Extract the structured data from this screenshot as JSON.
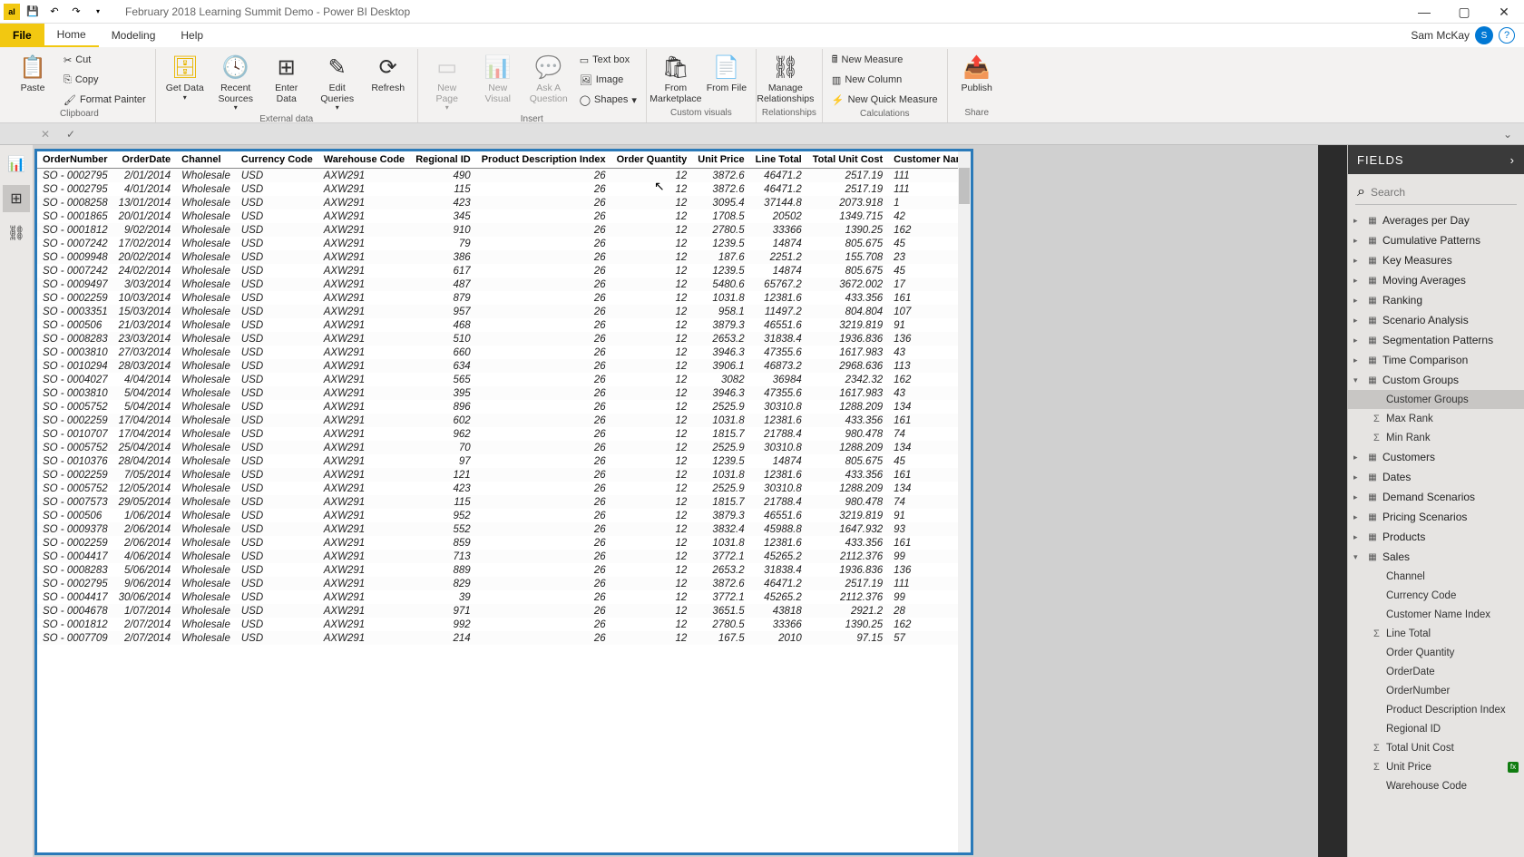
{
  "title": "February 2018 Learning Summit Demo - Power BI Desktop",
  "user": "Sam McKay",
  "tabs": {
    "file": "File",
    "home": "Home",
    "modeling": "Modeling",
    "help": "Help"
  },
  "ribbon": {
    "clipboard": {
      "paste": "Paste",
      "cut": "Cut",
      "copy": "Copy",
      "format_painter": "Format Painter",
      "label": "Clipboard"
    },
    "external": {
      "get_data": "Get Data",
      "recent": "Recent Sources",
      "enter": "Enter Data",
      "edit": "Edit Queries",
      "refresh": "Refresh",
      "label": "External data"
    },
    "insert": {
      "new_page": "New Page",
      "new_visual": "New Visual",
      "ask": "Ask A Question",
      "textbox": "Text box",
      "image": "Image",
      "shapes": "Shapes",
      "label": "Insert"
    },
    "custom": {
      "marketplace": "From Marketplace",
      "file": "From File",
      "label": "Custom visuals"
    },
    "rel": {
      "manage": "Manage Relationships",
      "label": "Relationships"
    },
    "calc": {
      "measure": "New Measure",
      "column": "New Column",
      "quick": "New Quick Measure",
      "label": "Calculations"
    },
    "share": {
      "publish": "Publish",
      "label": "Share"
    }
  },
  "fields_header": "FIELDS",
  "search_placeholder": "Search",
  "tables": [
    {
      "name": "Averages per Day",
      "exp": false
    },
    {
      "name": "Cumulative Patterns",
      "exp": false
    },
    {
      "name": "Key Measures",
      "exp": false
    },
    {
      "name": "Moving Averages",
      "exp": false
    },
    {
      "name": "Ranking",
      "exp": false
    },
    {
      "name": "Scenario Analysis",
      "exp": false
    },
    {
      "name": "Segmentation Patterns",
      "exp": false
    },
    {
      "name": "Time Comparison",
      "exp": false
    },
    {
      "name": "Custom Groups",
      "exp": true,
      "cols": [
        {
          "n": "Customer Groups",
          "sel": true
        },
        {
          "n": "Max Rank",
          "sigma": true
        },
        {
          "n": "Min Rank",
          "sigma": true
        }
      ]
    },
    {
      "name": "Customers",
      "exp": false
    },
    {
      "name": "Dates",
      "exp": false
    },
    {
      "name": "Demand Scenarios",
      "exp": false
    },
    {
      "name": "Pricing Scenarios",
      "exp": false
    },
    {
      "name": "Products",
      "exp": false
    },
    {
      "name": "Sales",
      "exp": true,
      "cols": [
        {
          "n": "Channel"
        },
        {
          "n": "Currency Code"
        },
        {
          "n": "Customer Name Index"
        },
        {
          "n": "Line Total",
          "sigma": true
        },
        {
          "n": "Order Quantity"
        },
        {
          "n": "OrderDate"
        },
        {
          "n": "OrderNumber"
        },
        {
          "n": "Product Description Index"
        },
        {
          "n": "Regional ID"
        },
        {
          "n": "Total Unit Cost",
          "sigma": true
        },
        {
          "n": "Unit Price",
          "sigma": true,
          "calc": true
        },
        {
          "n": "Warehouse Code"
        }
      ]
    }
  ],
  "columns": [
    "OrderNumber",
    "OrderDate",
    "Channel",
    "Currency Code",
    "Warehouse Code",
    "Regional ID",
    "Product Description Index",
    "Order Quantity",
    "Unit Price",
    "Line Total",
    "Total Unit Cost",
    "Customer Name Index"
  ],
  "col_align": [
    "l",
    "r",
    "l",
    "l",
    "l",
    "r",
    "r",
    "r",
    "r",
    "r",
    "r",
    "l"
  ],
  "rows": [
    [
      "SO - 0002795",
      "2/01/2014",
      "Wholesale",
      "USD",
      "AXW291",
      "490",
      "26",
      "12",
      "3872.6",
      "46471.2",
      "2517.19",
      "111"
    ],
    [
      "SO - 0002795",
      "4/01/2014",
      "Wholesale",
      "USD",
      "AXW291",
      "115",
      "26",
      "12",
      "3872.6",
      "46471.2",
      "2517.19",
      "111"
    ],
    [
      "SO - 0008258",
      "13/01/2014",
      "Wholesale",
      "USD",
      "AXW291",
      "423",
      "26",
      "12",
      "3095.4",
      "37144.8",
      "2073.918",
      "1"
    ],
    [
      "SO - 0001865",
      "20/01/2014",
      "Wholesale",
      "USD",
      "AXW291",
      "345",
      "26",
      "12",
      "1708.5",
      "20502",
      "1349.715",
      "42"
    ],
    [
      "SO - 0001812",
      "9/02/2014",
      "Wholesale",
      "USD",
      "AXW291",
      "910",
      "26",
      "12",
      "2780.5",
      "33366",
      "1390.25",
      "162"
    ],
    [
      "SO - 0007242",
      "17/02/2014",
      "Wholesale",
      "USD",
      "AXW291",
      "79",
      "26",
      "12",
      "1239.5",
      "14874",
      "805.675",
      "45"
    ],
    [
      "SO - 0009948",
      "20/02/2014",
      "Wholesale",
      "USD",
      "AXW291",
      "386",
      "26",
      "12",
      "187.6",
      "2251.2",
      "155.708",
      "23"
    ],
    [
      "SO - 0007242",
      "24/02/2014",
      "Wholesale",
      "USD",
      "AXW291",
      "617",
      "26",
      "12",
      "1239.5",
      "14874",
      "805.675",
      "45"
    ],
    [
      "SO - 0009497",
      "3/03/2014",
      "Wholesale",
      "USD",
      "AXW291",
      "487",
      "26",
      "12",
      "5480.6",
      "65767.2",
      "3672.002",
      "17"
    ],
    [
      "SO - 0002259",
      "10/03/2014",
      "Wholesale",
      "USD",
      "AXW291",
      "879",
      "26",
      "12",
      "1031.8",
      "12381.6",
      "433.356",
      "161"
    ],
    [
      "SO - 0003351",
      "15/03/2014",
      "Wholesale",
      "USD",
      "AXW291",
      "957",
      "26",
      "12",
      "958.1",
      "11497.2",
      "804.804",
      "107"
    ],
    [
      "SO - 000506",
      "21/03/2014",
      "Wholesale",
      "USD",
      "AXW291",
      "468",
      "26",
      "12",
      "3879.3",
      "46551.6",
      "3219.819",
      "91"
    ],
    [
      "SO - 0008283",
      "23/03/2014",
      "Wholesale",
      "USD",
      "AXW291",
      "510",
      "26",
      "12",
      "2653.2",
      "31838.4",
      "1936.836",
      "136"
    ],
    [
      "SO - 0003810",
      "27/03/2014",
      "Wholesale",
      "USD",
      "AXW291",
      "660",
      "26",
      "12",
      "3946.3",
      "47355.6",
      "1617.983",
      "43"
    ],
    [
      "SO - 0010294",
      "28/03/2014",
      "Wholesale",
      "USD",
      "AXW291",
      "634",
      "26",
      "12",
      "3906.1",
      "46873.2",
      "2968.636",
      "113"
    ],
    [
      "SO - 0004027",
      "4/04/2014",
      "Wholesale",
      "USD",
      "AXW291",
      "565",
      "26",
      "12",
      "3082",
      "36984",
      "2342.32",
      "162"
    ],
    [
      "SO - 0003810",
      "5/04/2014",
      "Wholesale",
      "USD",
      "AXW291",
      "395",
      "26",
      "12",
      "3946.3",
      "47355.6",
      "1617.983",
      "43"
    ],
    [
      "SO - 0005752",
      "5/04/2014",
      "Wholesale",
      "USD",
      "AXW291",
      "896",
      "26",
      "12",
      "2525.9",
      "30310.8",
      "1288.209",
      "134"
    ],
    [
      "SO - 0002259",
      "17/04/2014",
      "Wholesale",
      "USD",
      "AXW291",
      "602",
      "26",
      "12",
      "1031.8",
      "12381.6",
      "433.356",
      "161"
    ],
    [
      "SO - 0010707",
      "17/04/2014",
      "Wholesale",
      "USD",
      "AXW291",
      "962",
      "26",
      "12",
      "1815.7",
      "21788.4",
      "980.478",
      "74"
    ],
    [
      "SO - 0005752",
      "25/04/2014",
      "Wholesale",
      "USD",
      "AXW291",
      "70",
      "26",
      "12",
      "2525.9",
      "30310.8",
      "1288.209",
      "134"
    ],
    [
      "SO - 0010376",
      "28/04/2014",
      "Wholesale",
      "USD",
      "AXW291",
      "97",
      "26",
      "12",
      "1239.5",
      "14874",
      "805.675",
      "45"
    ],
    [
      "SO - 0002259",
      "7/05/2014",
      "Wholesale",
      "USD",
      "AXW291",
      "121",
      "26",
      "12",
      "1031.8",
      "12381.6",
      "433.356",
      "161"
    ],
    [
      "SO - 0005752",
      "12/05/2014",
      "Wholesale",
      "USD",
      "AXW291",
      "423",
      "26",
      "12",
      "2525.9",
      "30310.8",
      "1288.209",
      "134"
    ],
    [
      "SO - 0007573",
      "29/05/2014",
      "Wholesale",
      "USD",
      "AXW291",
      "115",
      "26",
      "12",
      "1815.7",
      "21788.4",
      "980.478",
      "74"
    ],
    [
      "SO - 000506",
      "1/06/2014",
      "Wholesale",
      "USD",
      "AXW291",
      "952",
      "26",
      "12",
      "3879.3",
      "46551.6",
      "3219.819",
      "91"
    ],
    [
      "SO - 0009378",
      "2/06/2014",
      "Wholesale",
      "USD",
      "AXW291",
      "552",
      "26",
      "12",
      "3832.4",
      "45988.8",
      "1647.932",
      "93"
    ],
    [
      "SO - 0002259",
      "2/06/2014",
      "Wholesale",
      "USD",
      "AXW291",
      "859",
      "26",
      "12",
      "1031.8",
      "12381.6",
      "433.356",
      "161"
    ],
    [
      "SO - 0004417",
      "4/06/2014",
      "Wholesale",
      "USD",
      "AXW291",
      "713",
      "26",
      "12",
      "3772.1",
      "45265.2",
      "2112.376",
      "99"
    ],
    [
      "SO - 0008283",
      "5/06/2014",
      "Wholesale",
      "USD",
      "AXW291",
      "889",
      "26",
      "12",
      "2653.2",
      "31838.4",
      "1936.836",
      "136"
    ],
    [
      "SO - 0002795",
      "9/06/2014",
      "Wholesale",
      "USD",
      "AXW291",
      "829",
      "26",
      "12",
      "3872.6",
      "46471.2",
      "2517.19",
      "111"
    ],
    [
      "SO - 0004417",
      "30/06/2014",
      "Wholesale",
      "USD",
      "AXW291",
      "39",
      "26",
      "12",
      "3772.1",
      "45265.2",
      "2112.376",
      "99"
    ],
    [
      "SO - 0004678",
      "1/07/2014",
      "Wholesale",
      "USD",
      "AXW291",
      "971",
      "26",
      "12",
      "3651.5",
      "43818",
      "2921.2",
      "28"
    ],
    [
      "SO - 0001812",
      "2/07/2014",
      "Wholesale",
      "USD",
      "AXW291",
      "992",
      "26",
      "12",
      "2780.5",
      "33366",
      "1390.25",
      "162"
    ],
    [
      "SO - 0007709",
      "2/07/2014",
      "Wholesale",
      "USD",
      "AXW291",
      "214",
      "26",
      "12",
      "167.5",
      "2010",
      "97.15",
      "57"
    ]
  ]
}
